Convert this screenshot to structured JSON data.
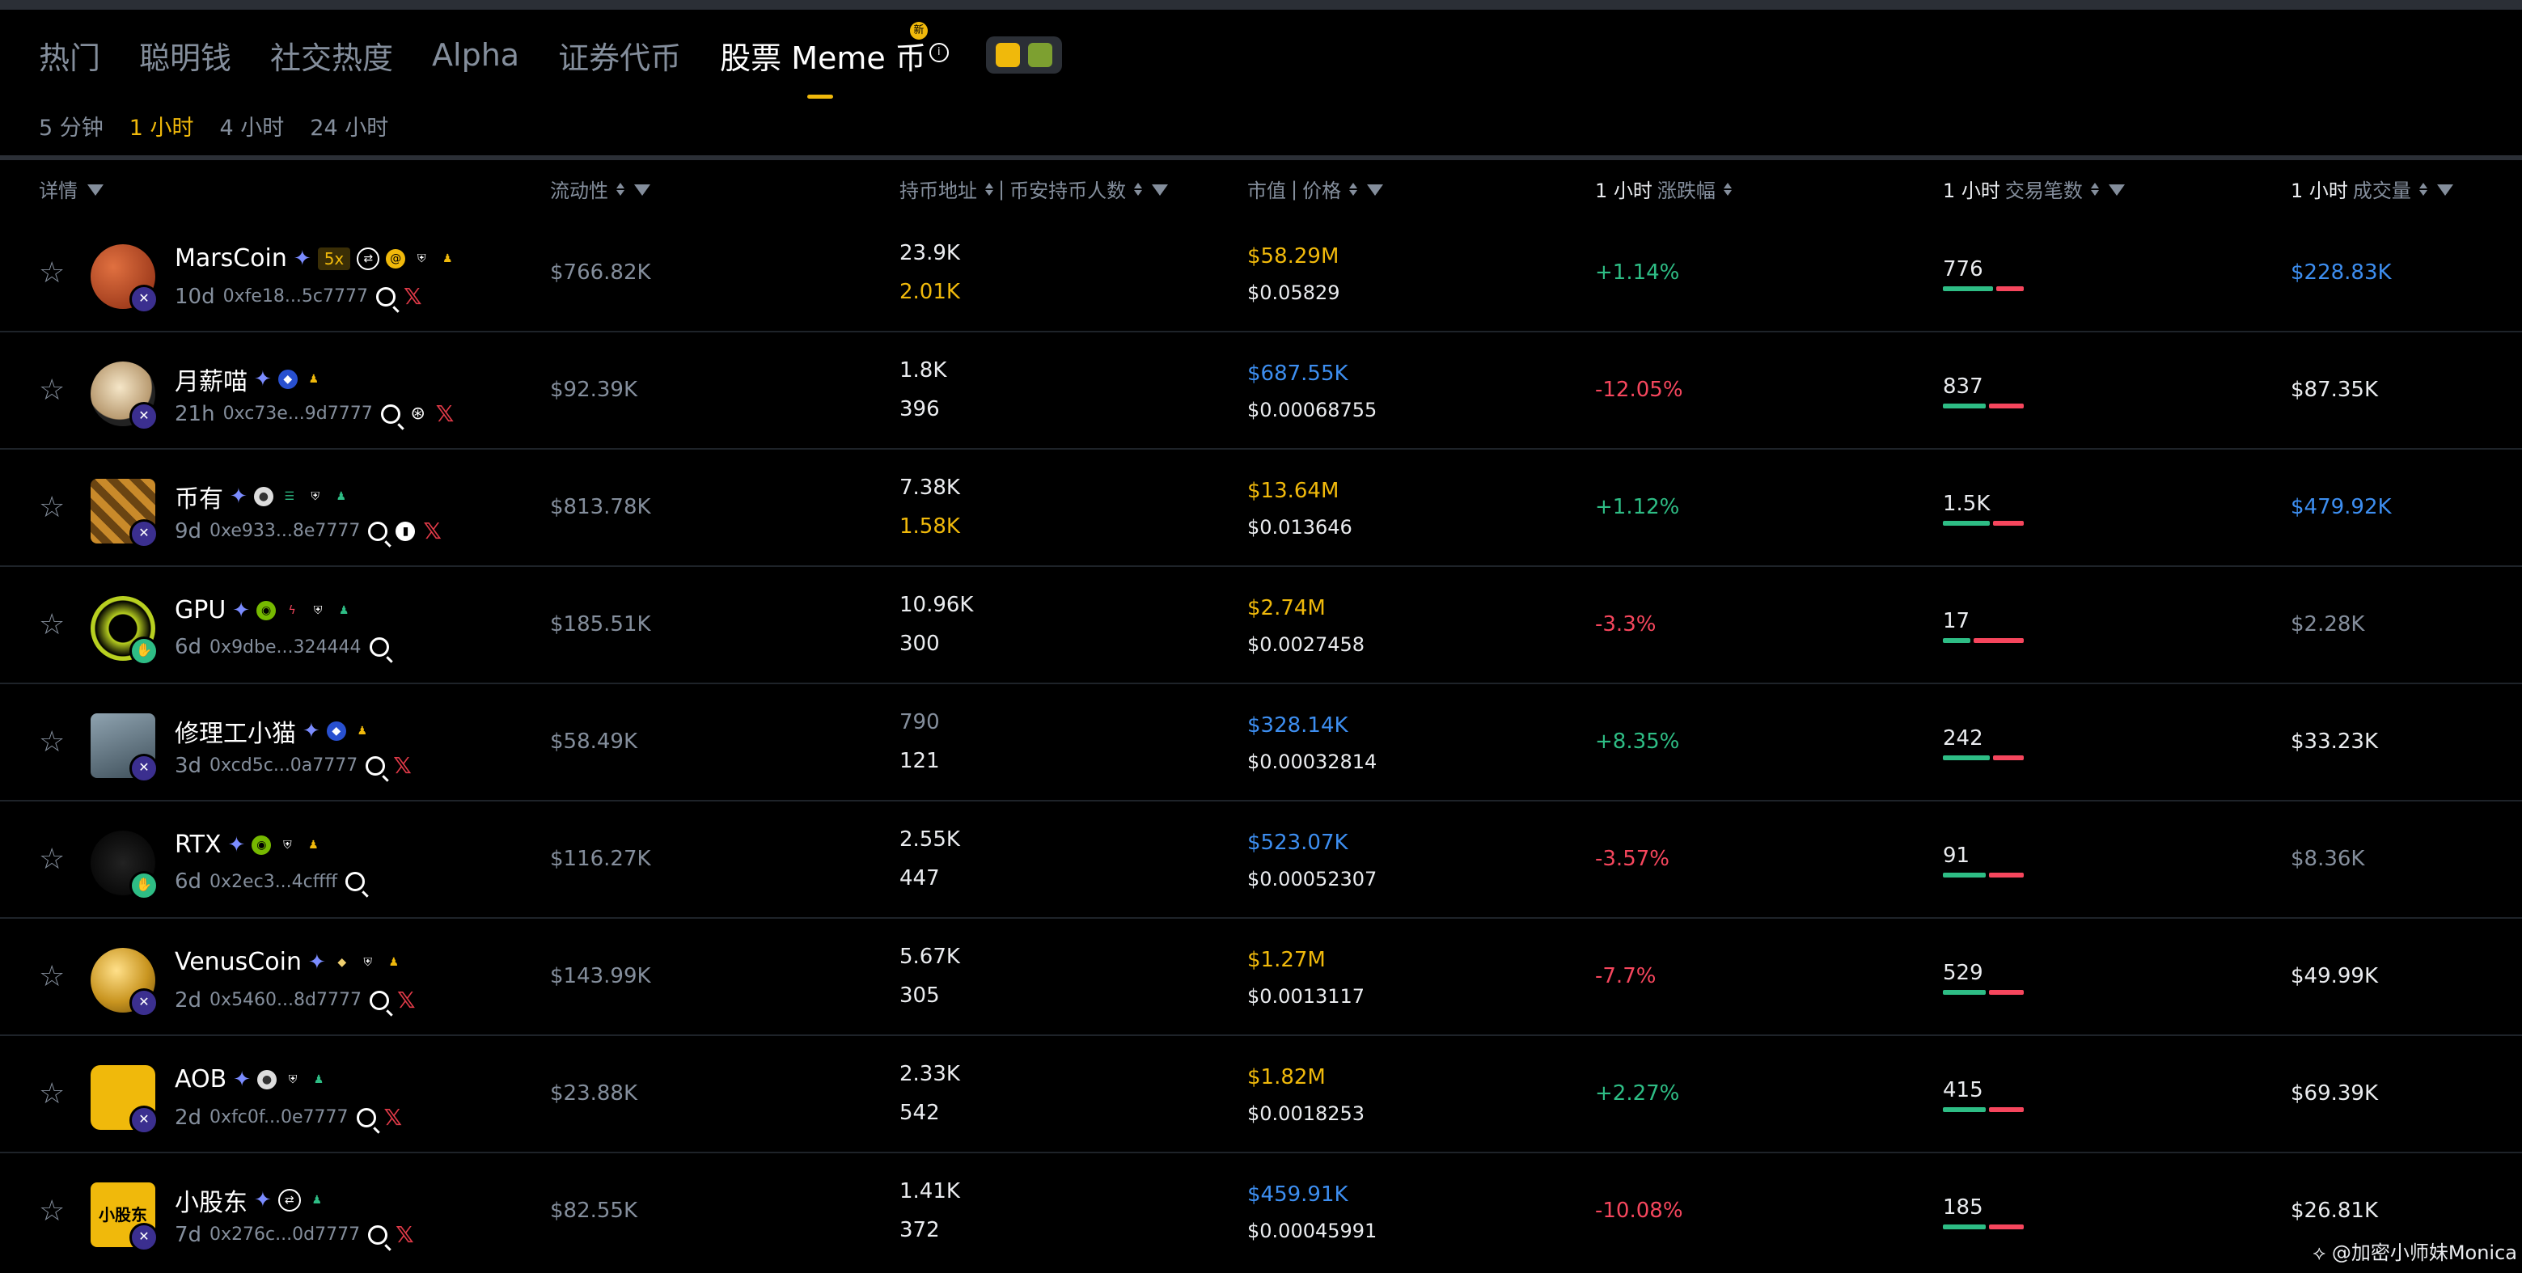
{
  "tabs": [
    {
      "label": "热门"
    },
    {
      "label": "聪明钱"
    },
    {
      "label": "社交热度"
    },
    {
      "label": "Alpha"
    },
    {
      "label": "证券代币"
    },
    {
      "label": "股票 Meme 币",
      "new_badge": "新"
    }
  ],
  "timeframes": [
    "5 分钟",
    "1 小时",
    "4 小时",
    "24 小时"
  ],
  "columns": {
    "details": "详情",
    "liquidity": "流动性",
    "holders": "持币地址",
    "binance_holders": "币安持币人数",
    "mcap": "市值",
    "price": "价格",
    "change_hl": "1 小时",
    "change_rest": "涨跌幅",
    "tx_hl": "1 小时",
    "tx_rest": "交易笔数",
    "vol_hl": "1 小时",
    "vol_rest": "成交量"
  },
  "rows": [
    {
      "name": "MarsCoin",
      "leverage": "5x",
      "age": "10d",
      "address": "0xfe18...5c7777",
      "liquidity": "$766.82K",
      "holders": "23.9K",
      "binance_holders": "2.01K",
      "mcap": "$58.29M",
      "price": "$0.05829",
      "change": "+1.14%",
      "txs": "776",
      "tx_buy": 0.65,
      "volume": "$228.83K"
    },
    {
      "name": "月薪喵",
      "age": "21h",
      "address": "0xc73e...9d7777",
      "liquidity": "$92.39K",
      "holders": "1.8K",
      "binance_holders": "396",
      "mcap": "$687.55K",
      "price": "$0.00068755",
      "change": "-12.05%",
      "txs": "837",
      "tx_buy": 0.55,
      "volume": "$87.35K"
    },
    {
      "name": "币有",
      "age": "9d",
      "address": "0xe933...8e7777",
      "liquidity": "$813.78K",
      "holders": "7.38K",
      "binance_holders": "1.58K",
      "mcap": "$13.64M",
      "price": "$0.013646",
      "change": "+1.12%",
      "txs": "1.5K",
      "tx_buy": 0.6,
      "volume": "$479.92K"
    },
    {
      "name": "GPU",
      "age": "6d",
      "address": "0x9dbe...324444",
      "liquidity": "$185.51K",
      "holders": "10.96K",
      "binance_holders": "300",
      "mcap": "$2.74M",
      "price": "$0.0027458",
      "change": "-3.3%",
      "txs": "17",
      "tx_buy": 0.35,
      "volume": "$2.28K"
    },
    {
      "name": "修理工小猫",
      "age": "3d",
      "address": "0xcd5c...0a7777",
      "liquidity": "$58.49K",
      "holders": "790",
      "binance_holders": "121",
      "mcap": "$328.14K",
      "price": "$0.00032814",
      "change": "+8.35%",
      "txs": "242",
      "tx_buy": 0.6,
      "volume": "$33.23K"
    },
    {
      "name": "RTX",
      "age": "6d",
      "address": "0x2ec3...4cffff",
      "liquidity": "$116.27K",
      "holders": "2.55K",
      "binance_holders": "447",
      "mcap": "$523.07K",
      "price": "$0.00052307",
      "change": "-3.57%",
      "txs": "91",
      "tx_buy": 0.55,
      "volume": "$8.36K"
    },
    {
      "name": "VenusCoin",
      "age": "2d",
      "address": "0x5460...8d7777",
      "liquidity": "$143.99K",
      "holders": "5.67K",
      "binance_holders": "305",
      "mcap": "$1.27M",
      "price": "$0.0013117",
      "change": "-7.7%",
      "txs": "529",
      "tx_buy": 0.55,
      "volume": "$49.99K"
    },
    {
      "name": "AOB",
      "age": "2d",
      "address": "0xfc0f...0e7777",
      "liquidity": "$23.88K",
      "holders": "2.33K",
      "binance_holders": "542",
      "mcap": "$1.82M",
      "price": "$0.0018253",
      "change": "+2.27%",
      "txs": "415",
      "tx_buy": 0.55,
      "volume": "$69.39K"
    },
    {
      "name": "小股东",
      "logo_text": "小股东",
      "age": "7d",
      "address": "0x276c...0d7777",
      "liquidity": "$82.55K",
      "holders": "1.41K",
      "binance_holders": "372",
      "mcap": "$459.91K",
      "price": "$0.00045991",
      "change": "-10.08%",
      "txs": "185",
      "tx_buy": 0.55,
      "volume": "$26.81K"
    }
  ],
  "watermark": "@加密小师妹Monica",
  "colors": {
    "accent": "#f0b90b",
    "up": "#2ebd85",
    "down": "#f6465d",
    "blue": "#3d8ef0"
  }
}
